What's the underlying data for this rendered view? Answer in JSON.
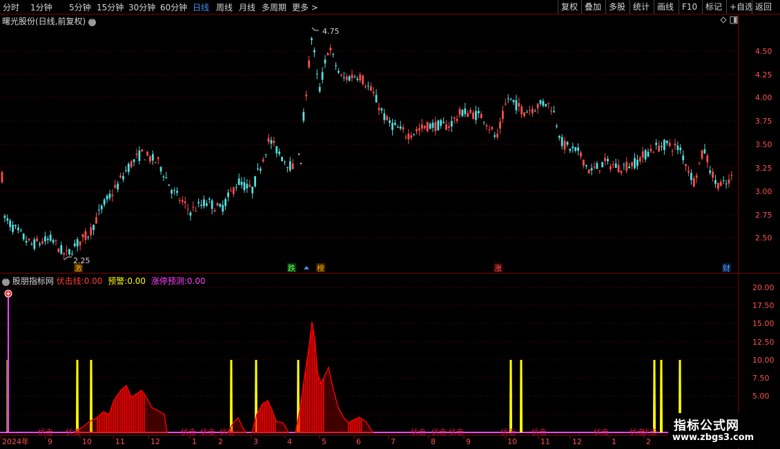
{
  "toolbar": {
    "periods": [
      "分时",
      "1分钟",
      "5分钟",
      "15分钟",
      "30分钟",
      "60分钟",
      "日线",
      "周线",
      "月线",
      "多周期",
      "更多 >"
    ],
    "active": "日线",
    "right_buttons": [
      "复权",
      "叠加",
      "多股",
      "统计",
      "画线",
      "F10",
      "标记",
      "+自选",
      "返回"
    ]
  },
  "main_panel": {
    "title": "曙光股份(日线,前复权)",
    "high_label": "4.75",
    "low_label": "2.25",
    "y_ticks": [
      "4.50",
      "4.25",
      "4.00",
      "3.75",
      "3.50",
      "3.25",
      "3.00",
      "2.75",
      "2.50"
    ],
    "markers": [
      "激",
      "跌",
      "榜",
      "涨",
      "财"
    ]
  },
  "indicator_panel": {
    "name": "股朋指标网",
    "line1_label": "伏击线:",
    "line1_value": "0.00",
    "line2_label": "预警:",
    "line2_value": "0.00",
    "line3_label": "涨停预测:",
    "line3_value": "0.00",
    "y_ticks": [
      "20.00",
      "17.50",
      "15.00",
      "12.50",
      "10.00",
      "7.50",
      "5.00"
    ],
    "bottom_text": "伏击"
  },
  "x_axis": {
    "labels": [
      "2024年",
      "9",
      "10",
      "11",
      "12",
      "1",
      "2",
      "3",
      "4",
      "5",
      "6",
      "7",
      "8",
      "9",
      "10",
      "11",
      "12",
      "1",
      "2"
    ]
  },
  "watermark": {
    "line1": "指标公式网",
    "line2": "www.zbgs3.com"
  },
  "colors": {
    "up": "#ff4d4d",
    "down": "#52e0e0",
    "grid": "#4a0000",
    "accent_blue": "#4a8ff0",
    "yellow": "#ffff00",
    "magenta": "#ff40ff",
    "red_fill": "#ff0000"
  },
  "chart_data": {
    "type": "candlestick",
    "y_range": [
      2.25,
      4.75
    ],
    "indicator_range": [
      0,
      20
    ]
  }
}
